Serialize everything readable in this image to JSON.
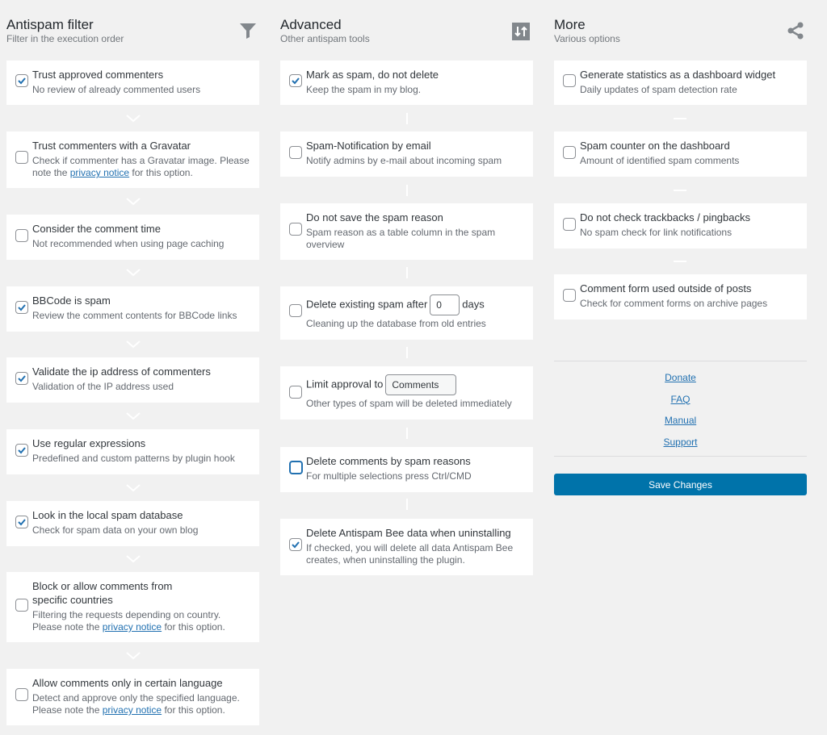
{
  "columns": [
    {
      "title": "Antispam filter",
      "subtitle": "Filter in the execution order",
      "icon": "filter-icon",
      "options": [
        {
          "label": "Trust approved commenters",
          "desc": "No review of already commented users",
          "checked": true
        },
        {
          "label": "Trust commenters with a Gravatar",
          "desc_pre": "Check if commenter has a Gravatar image. Please note the ",
          "link": "privacy notice",
          "desc_post": " for this option.",
          "checked": false
        },
        {
          "label": "Consider the comment time",
          "desc": "Not recommended when using page caching",
          "checked": false
        },
        {
          "label": "BBCode is spam",
          "desc": "Review the comment contents for BBCode links",
          "checked": true
        },
        {
          "label": "Validate the ip address of commenters",
          "desc": "Validation of the IP address used",
          "checked": true
        },
        {
          "label": "Use regular expressions",
          "desc": "Predefined and custom patterns by plugin hook",
          "checked": true
        },
        {
          "label": "Look in the local spam database",
          "desc": "Check for spam data on your own blog",
          "checked": true
        },
        {
          "label": "Block or allow comments from specific countries",
          "desc_pre": "Filtering the requests depending on country. Please note the ",
          "link": "privacy notice",
          "desc_post": " for this option.",
          "checked": false
        },
        {
          "label": "Allow comments only in certain language",
          "desc_pre": "Detect and approve only the specified language. Please note the ",
          "link": "privacy notice",
          "desc_post": " for this option.",
          "checked": false
        }
      ]
    },
    {
      "title": "Advanced",
      "subtitle": "Other antispam tools",
      "icon": "sort-icon",
      "options": [
        {
          "label": "Mark as spam, do not delete",
          "desc": "Keep the spam in my blog.",
          "checked": true
        },
        {
          "label": "Spam-Notification by email",
          "desc": "Notify admins by e-mail about incoming spam",
          "checked": false
        },
        {
          "label": "Do not save the spam reason",
          "desc": "Spam reason as a table column in the spam overview",
          "checked": false
        },
        {
          "label_pre": "Delete existing spam after",
          "input_value": "0",
          "label_post": "days",
          "desc": "Cleaning up the database from old entries",
          "checked": false
        },
        {
          "label_pre": "Limit approval to",
          "select_value": "Comments",
          "desc": "Other types of spam will be deleted immediately",
          "checked": false
        },
        {
          "label": "Delete comments by spam reasons",
          "desc": "For multiple selections press Ctrl/CMD",
          "checked": false,
          "focused": true
        },
        {
          "label": "Delete Antispam Bee data when uninstalling",
          "desc": "If checked, you will delete all data Antispam Bee creates, when uninstalling the plugin.",
          "checked": true
        }
      ]
    },
    {
      "title": "More",
      "subtitle": "Various options",
      "icon": "share-icon",
      "options": [
        {
          "label": "Generate statistics as a dashboard widget",
          "desc": "Daily updates of spam detection rate",
          "checked": false
        },
        {
          "label": "Spam counter on the dashboard",
          "desc": "Amount of identified spam comments",
          "checked": false
        },
        {
          "label": "Do not check trackbacks / pingbacks",
          "desc": "No spam check for link notifications",
          "checked": false
        },
        {
          "label": "Comment form used outside of posts",
          "desc": "Check for comment forms on archive pages",
          "checked": false
        }
      ],
      "links": [
        "Donate",
        "FAQ",
        "Manual",
        "Support"
      ],
      "save_label": "Save Changes"
    }
  ],
  "colors": {
    "accent": "#2271b1",
    "button": "#0073aa",
    "background": "#f1f1f1"
  }
}
